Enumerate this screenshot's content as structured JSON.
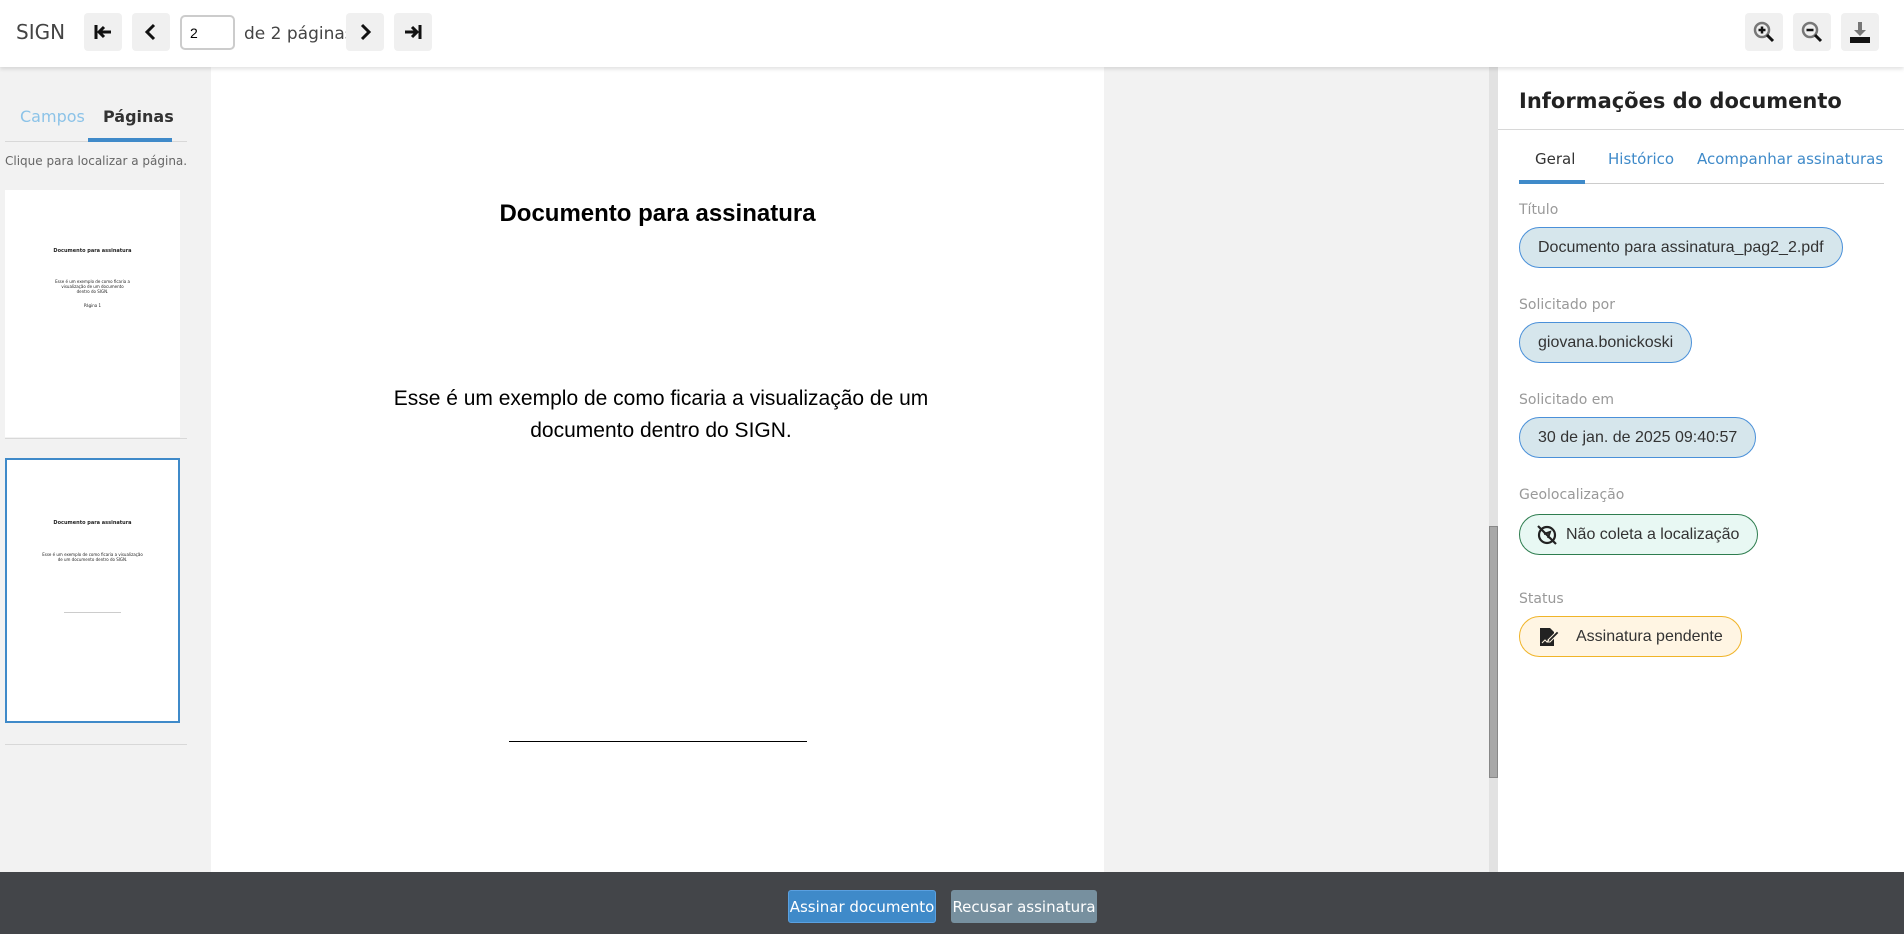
{
  "topbar": {
    "brand": "SIGN",
    "current_page": "2",
    "page_suffix": "de 2 páginas"
  },
  "left": {
    "tabs": [
      "Campos",
      "Páginas"
    ],
    "hint": "Clique para localizar a página.",
    "thumbs": [
      {
        "title": "Documento para assinatura",
        "body": "Esse é um exemplo de como ficaria a visualização de um documento dentro do SIGN.",
        "footer": "Página 1"
      },
      {
        "title": "Documento para assinatura",
        "body": "Esse é um exemplo de como ficaria a visualização de um documento dentro do SIGN."
      }
    ]
  },
  "document": {
    "title": "Documento para assinatura",
    "body": "Esse é um exemplo de como ficaria a visualização de um documento dentro do SIGN."
  },
  "right": {
    "title": "Informações do documento",
    "tabs": [
      "Geral",
      "Histórico",
      "Acompanhar assinaturas"
    ],
    "fields": [
      {
        "label": "Título",
        "value": "Documento para assinatura_pag2_2.pdf"
      },
      {
        "label": "Solicitado por",
        "value": "giovana.bonickoski"
      },
      {
        "label": "Solicitado em",
        "value": "30 de jan. de 2025 09:40:57"
      },
      {
        "label": "Geolocalização",
        "value": "Não coleta a localização"
      },
      {
        "label": "Status",
        "value": "Assinatura pendente"
      }
    ]
  },
  "actions": {
    "sign": "Assinar documento",
    "refuse": "Recusar assinatura"
  },
  "colors": {
    "accent": "#3f8ac9",
    "refuse": "#77909f",
    "geo_bg": "#e8f8f3",
    "geo_border": "#2e7d4f",
    "status_bg": "#fff5e3",
    "status_border": "#f0b429"
  }
}
